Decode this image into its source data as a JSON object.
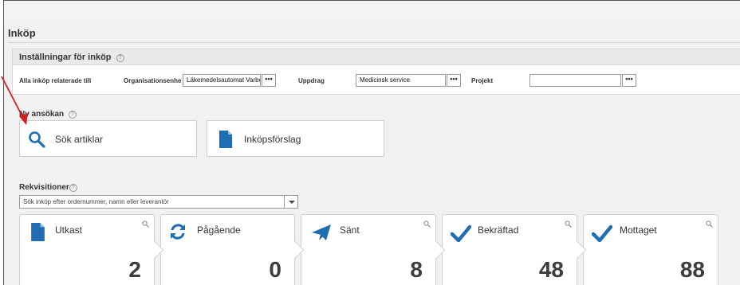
{
  "page": {
    "title": "Inköp"
  },
  "settings": {
    "header": "Inställningar för inköp",
    "help_glyph": "?",
    "row_label": "Alla inköp relaterade till",
    "org_label": "Organisationsenhe",
    "org_value": "Läkemedelsautomat Varbe",
    "assignment_label": "Uppdrag",
    "assignment_value": "Medicinsk service",
    "project_label": "Projekt",
    "project_value": "",
    "lookup_glyph": "•••"
  },
  "new_application": {
    "label": "Ny ansökan",
    "search_articles": "Sök artiklar",
    "purchase_suggestion": "Inköpsförslag"
  },
  "requisitions": {
    "label": "Rekvisitioner",
    "search_placeholder": "Sök inköp efter ordernummer, namn eller leverantör",
    "tiles": [
      {
        "label": "Utkast",
        "count": "2",
        "icon": "document-icon"
      },
      {
        "label": "Pågående",
        "count": "0",
        "icon": "refresh-icon"
      },
      {
        "label": "Sänt",
        "count": "8",
        "icon": "paper-plane-icon"
      },
      {
        "label": "Bekräftad",
        "count": "48",
        "icon": "checkmark-icon"
      },
      {
        "label": "Mottaget",
        "count": "88",
        "icon": "checkmark-icon"
      }
    ]
  },
  "colors": {
    "accent": "#1f6db3",
    "annotation_arrow": "#d42020"
  }
}
